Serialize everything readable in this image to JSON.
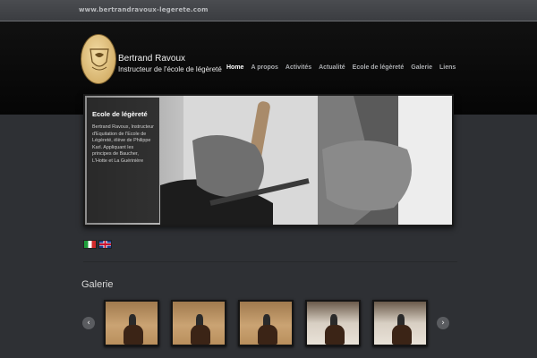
{
  "site": {
    "url": "www.bertrandravoux-legerete.com"
  },
  "brand": {
    "name": "Bertrand Ravoux",
    "subtitle": "Instructeur de l'école de légèreté"
  },
  "nav": {
    "items": [
      {
        "label": "Home",
        "active": true
      },
      {
        "label": "A propos",
        "active": false
      },
      {
        "label": "Activités",
        "active": false
      },
      {
        "label": "Actualité",
        "active": false
      },
      {
        "label": "Ecole de légèreté",
        "active": false
      },
      {
        "label": "Galerie",
        "active": false
      },
      {
        "label": "Liens",
        "active": false
      }
    ]
  },
  "slider": {
    "caption_title": "Ecole de légèreté",
    "caption_text": "Bertrand Ravoux, Instructeur d'Equitation de l'Ecole de Légèreté, élève de Philippe Karl. Appliquant les principes de Baucher, L'Hotte et La Guérinière"
  },
  "languages": [
    {
      "icon": "italian-flag-icon"
    },
    {
      "icon": "uk-flag-icon"
    }
  ],
  "gallery": {
    "title": "Galerie",
    "prev_icon": "chevron-left-icon",
    "next_icon": "chevron-right-icon",
    "thumbnails": 5
  },
  "colors": {
    "header_bg": "#0a0a0a",
    "page_bg": "#2e3034",
    "nav_active": "#ffffff",
    "nav_inactive": "#a9abae"
  }
}
